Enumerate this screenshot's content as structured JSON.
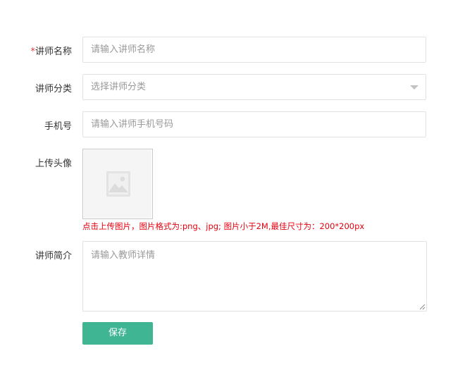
{
  "form": {
    "name": {
      "required_mark": "*",
      "label": "讲师名称",
      "placeholder": "请输入讲师名称"
    },
    "category": {
      "label": "讲师分类",
      "placeholder": "选择讲师分类"
    },
    "phone": {
      "label": "手机号",
      "placeholder": "请输入讲师手机号码"
    },
    "avatar": {
      "label": "上传头像",
      "hint": "点击上传图片，图片格式为:png、jpg; 图片小于2M,最佳尺寸为：200*200px"
    },
    "intro": {
      "label": "讲师简介",
      "placeholder": "请输入教师详情"
    },
    "save_label": "保存"
  },
  "colors": {
    "required": "#e4393c",
    "hint": "#e4000f",
    "save_button": "#3fb594"
  },
  "icons": {
    "select_caret": "chevron-down-icon",
    "avatar_placeholder": "image-placeholder-icon",
    "resize_grip": "resize-grip-icon"
  }
}
